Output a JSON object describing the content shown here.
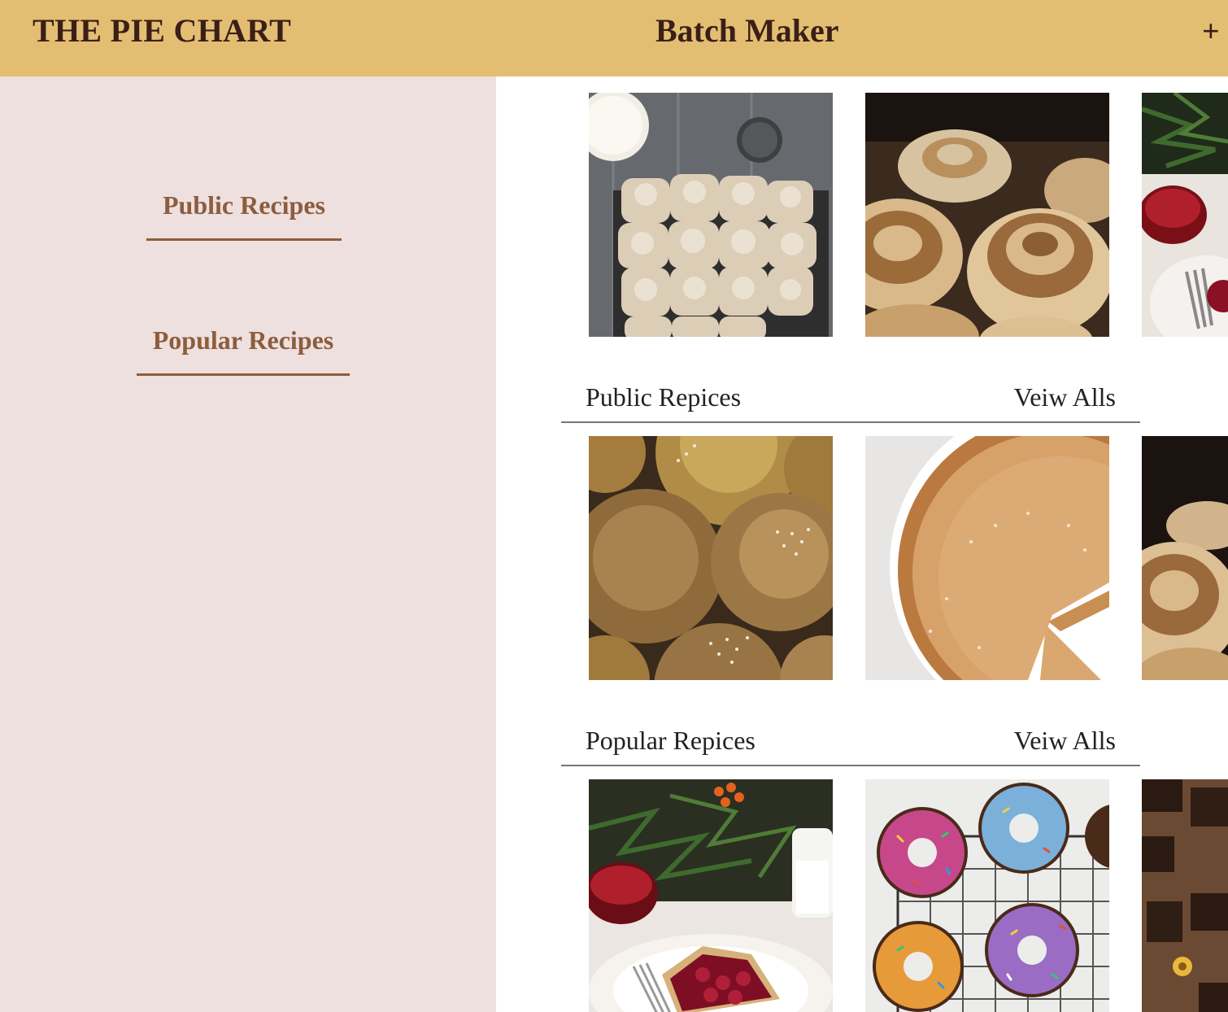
{
  "header": {
    "brand": "THE PIE CHART",
    "title": "Batch Maker",
    "add_label": "+"
  },
  "sidebar": {
    "items": [
      {
        "label": "Public Recipes"
      },
      {
        "label": "Popular Recipes"
      }
    ]
  },
  "main": {
    "sections": [
      {
        "title": "Public Repices",
        "view_all": "Veiw Alls"
      },
      {
        "title": "Popular Repices",
        "view_all": "Veiw Alls"
      }
    ],
    "images": [
      "rolls-on-cooling-rack",
      "cinnamon-rolls",
      "cherry-pie-partial",
      "sesame-buns",
      "custard-pie",
      "cinnamon-rolls-partial",
      "cherry-pie-slice",
      "sprinkle-donuts",
      "brownies-partial"
    ]
  },
  "colors": {
    "header_bg": "#e3be72",
    "sidebar_bg": "#eee0de",
    "brand_text": "#3a1f18",
    "nav_text": "#8c5d3e"
  }
}
